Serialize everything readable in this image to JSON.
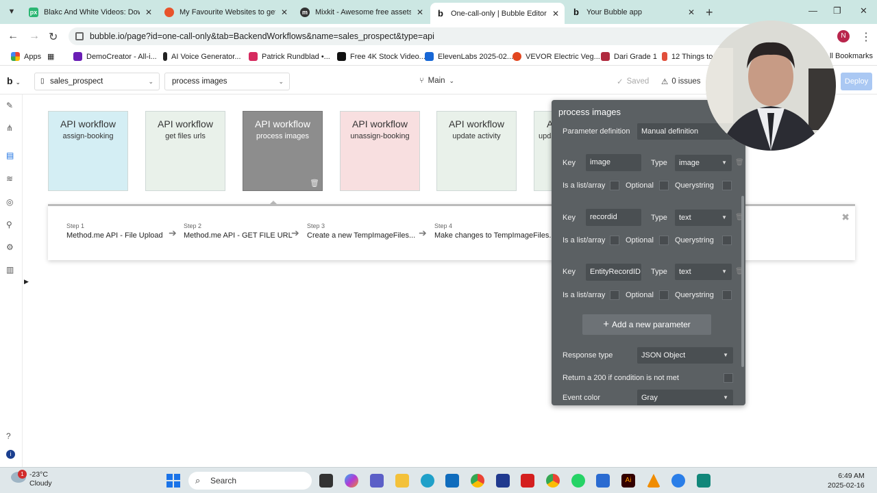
{
  "browser": {
    "tabs": [
      {
        "title": "Blakc And White Videos: Downl",
        "active": false
      },
      {
        "title": "My Favourite Websites to get st",
        "active": false
      },
      {
        "title": "Mixkit - Awesome free assets fo",
        "active": false
      },
      {
        "title": "One-call-only | Bubble Editor",
        "active": true
      },
      {
        "title": "Your Bubble app",
        "active": false
      }
    ],
    "url": "bubble.io/page?id=one-call-only&tab=BackendWorkflows&name=sales_prospect&type=api",
    "profile_initial": "N",
    "bookmarks": [
      "Apps",
      "DemoCreator - All-i...",
      "AI Voice Generator...",
      "Patrick Rundblad •...",
      "Free 4K Stock Video...",
      "ElevenLabs 2025-02...",
      "VEVOR Electric Veg...",
      "Dari Grade 1",
      "12 Things to",
      "ll Bookmarks"
    ]
  },
  "editor": {
    "logo": "b",
    "page_select": "sales_prospect",
    "workflow_select": "process images",
    "branch": "Main",
    "saved_label": "Saved",
    "issues_label": "0 issues",
    "deploy_label": "Deploy"
  },
  "workflows": [
    {
      "heading": "API workflow",
      "name": "assign-booking",
      "color": "#d4eef4"
    },
    {
      "heading": "API workflow",
      "name": "get files urls",
      "color": "#e9f1ea"
    },
    {
      "heading": "API workflow",
      "name": "process images",
      "color": "#8d8d8d"
    },
    {
      "heading": "API workflow",
      "name": "unassign-booking",
      "color": "#f8dfe0"
    },
    {
      "heading": "API workflow",
      "name": "update activity",
      "color": "#e9f1ea"
    },
    {
      "heading": "A",
      "name": "upda",
      "color": "#e9f1ea"
    }
  ],
  "steps": [
    {
      "num": "Step 1",
      "title": "Method.me API - File Upload"
    },
    {
      "num": "Step 2",
      "title": "Method.me API - GET FILE URL"
    },
    {
      "num": "Step 3",
      "title": "Create a new TempImageFiles..."
    },
    {
      "num": "Step 4",
      "title": "Make changes to TempImageFiles..."
    }
  ],
  "property_editor": {
    "title": "process images",
    "param_def_label": "Parameter definition",
    "param_def_value": "Manual definition",
    "key_label": "Key",
    "type_label": "Type",
    "list_label": "Is a list/array",
    "optional_label": "Optional",
    "querystring_label": "Querystring",
    "params": [
      {
        "key": "image",
        "type": "image"
      },
      {
        "key": "recordid",
        "type": "text"
      },
      {
        "key": "EntityRecordID",
        "type": "text"
      }
    ],
    "add_param_label": "Add a new parameter",
    "response_type_label": "Response type",
    "response_type_value": "JSON Object",
    "return200_label": "Return a 200 if condition is not met",
    "event_color_label": "Event color",
    "event_color_value": "Gray"
  },
  "taskbar": {
    "temp": "-23°C",
    "weather": "Cloudy",
    "weather_badge": "1",
    "search_label": "Search",
    "time": "6:49 AM",
    "date": "2025-02-16"
  }
}
